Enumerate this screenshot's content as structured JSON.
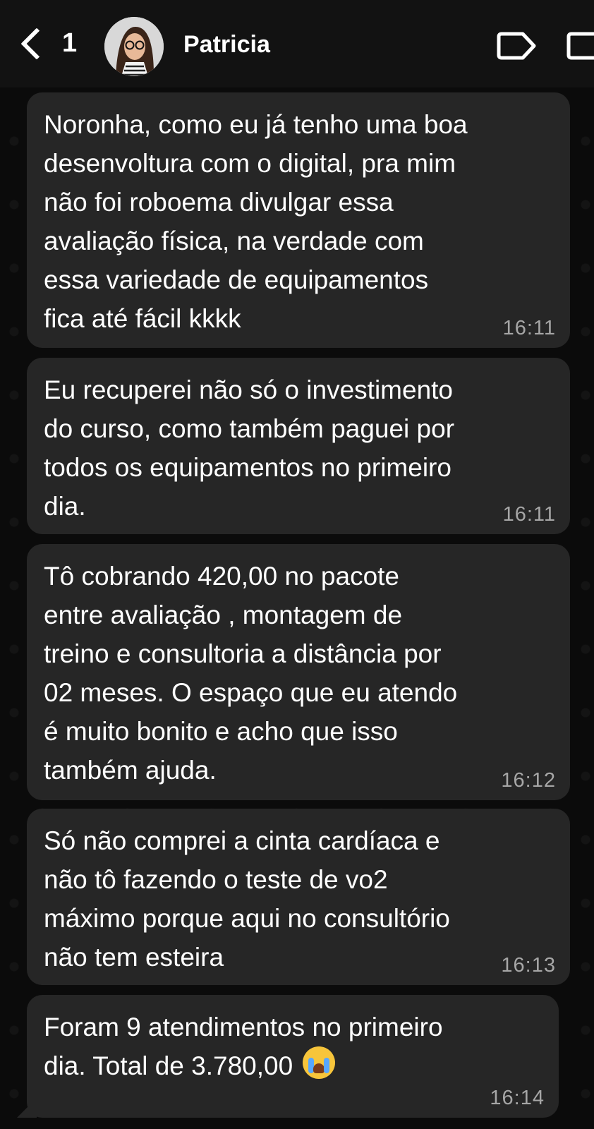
{
  "header": {
    "unread_count": "1",
    "contact_name": "Patricia"
  },
  "icons": {
    "back": "chevron-left-icon",
    "tag": "tag-icon",
    "square": "square-icon",
    "emoji": "loudly-crying-face"
  },
  "colors": {
    "background": "#0b0b0b",
    "bubble": "#262626",
    "text": "#ffffff",
    "timestamp": "#a6a6a6"
  },
  "messages": [
    {
      "text": "Noronha, como eu já tenho uma boa\ndesenvoltura com o digital, pra mim\nnão foi roboema divulgar essa\navaliação física, na verdade com\nessa variedade de equipamentos\nfica até fácil kkkk",
      "time": "16:11"
    },
    {
      "text": "Eu recuperei não só o investimento\ndo curso, como também paguei por\ntodos os equipamentos no primeiro\ndia.",
      "time": "16:11"
    },
    {
      "text": "Tô cobrando 420,00 no pacote\nentre avaliação , montagem de\ntreino e consultoria a distância por\n02 meses. O espaço que eu atendo\né muito bonito e acho que isso\ntambém ajuda.",
      "time": "16:12"
    },
    {
      "text": "Só não comprei a cinta cardíaca e\nnão tô fazendo o teste de vo2\nmáximo porque aqui no consultório\nnão tem esteira",
      "time": "16:13"
    },
    {
      "text_line1": "Foram 9 atendimentos no primeiro",
      "text_line2": "dia. Total de 3.780,00",
      "time": "16:14"
    }
  ]
}
